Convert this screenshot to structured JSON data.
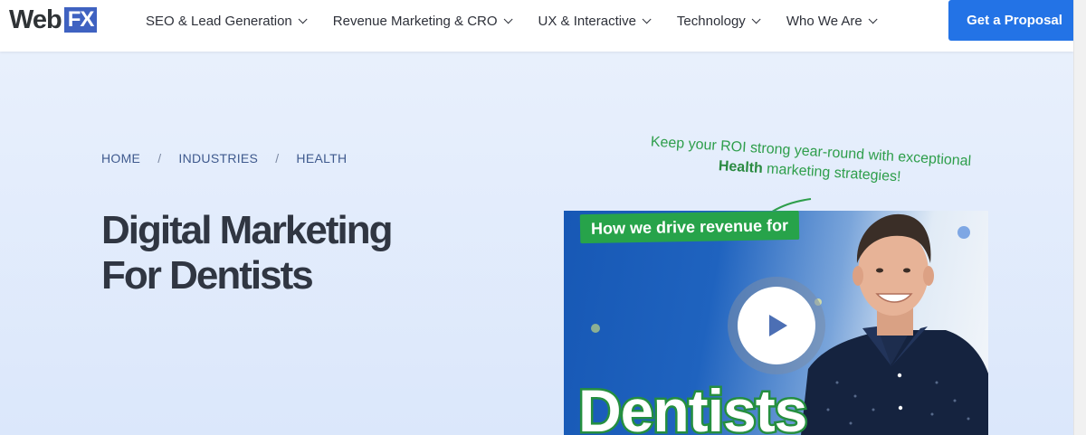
{
  "header": {
    "logo": {
      "part1": "Web",
      "part2": "FX"
    },
    "nav": [
      {
        "label": "SEO & Lead Generation"
      },
      {
        "label": "Revenue Marketing & CRO"
      },
      {
        "label": "UX & Interactive"
      },
      {
        "label": "Technology"
      },
      {
        "label": "Who We Are"
      }
    ],
    "cta_label": "Get a Proposal"
  },
  "breadcrumb": [
    "HOME",
    "INDUSTRIES",
    "HEALTH"
  ],
  "breadcrumb_separator": "/",
  "title": {
    "line1": "Digital Marketing",
    "line2": "For Dentists"
  },
  "tagline": {
    "line1": "Keep your ROI strong year-round with exceptional",
    "bold": "Health",
    "line2_rest": " marketing strategies!"
  },
  "video": {
    "badge": "How we drive revenue for",
    "big_word": "Dentists"
  },
  "colors": {
    "brand_blue": "#3f62c1",
    "cta_blue": "#2373e6",
    "green": "#2e9e4b",
    "title_dark": "#303642"
  }
}
